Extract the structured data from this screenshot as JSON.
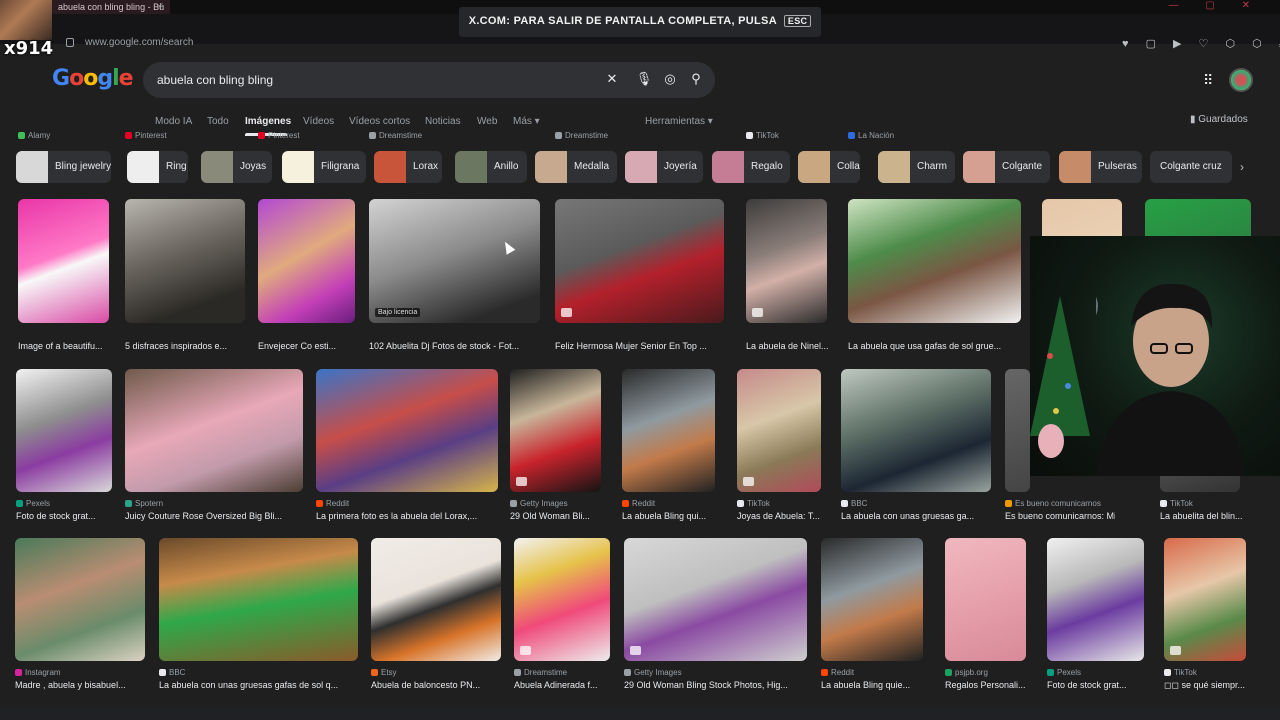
{
  "browser": {
    "tab_title": "abuela con bling bling - Bú",
    "url": "www.google.com/search",
    "fullscreen_banner": "X.COM: PARA SALIR DE PANTALLA COMPLETA, PULSA",
    "fullscreen_key": "ESC",
    "new_tab": "+",
    "window_controls": "— ▢ ✕",
    "extension_icons": "♥ ▢ ▶ ♡ ⬡ ⬡ ⤓ ☰"
  },
  "overlay": {
    "streamer_tag": "x914"
  },
  "google": {
    "logo": "Google",
    "query": "abuela con bling bling",
    "nav_tabs": [
      "Modo IA",
      "Todo",
      "Imágenes",
      "Vídeos",
      "Vídeos cortos",
      "Noticias",
      "Web",
      "Más ▾"
    ],
    "tools": "Herramientas ▾",
    "saved": "Guardados"
  },
  "chips": [
    {
      "label": "Bling jewelry",
      "color": "#d8d8d8"
    },
    {
      "label": "Ring",
      "color": "#eeeeee"
    },
    {
      "label": "Joyas",
      "color": "#8a8a7a"
    },
    {
      "label": "Filigrana",
      "color": "#f6f1dd"
    },
    {
      "label": "Lorax",
      "color": "#c8553a"
    },
    {
      "label": "Anillo",
      "color": "#6b7760"
    },
    {
      "label": "Medalla",
      "color": "#c6a98f"
    },
    {
      "label": "Joyería",
      "color": "#d7a9b3"
    },
    {
      "label": "Regalo",
      "color": "#c47d95"
    },
    {
      "label": "Collar",
      "color": "#c9a881"
    },
    {
      "label": "Charm",
      "color": "#cbb48d"
    },
    {
      "label": "Colgante",
      "color": "#d59f92"
    },
    {
      "label": "Pulseras",
      "color": "#c68c6a"
    },
    {
      "label": "Colgante cruz"
    }
  ],
  "results": [
    {
      "source": "Alamy",
      "source_color": "#3fbf5a",
      "caption": "Image of a beautifu...",
      "bg": "linear-gradient(160deg,#e936a8,#ff79c6 45%,#f8f8f8 55%,#d94aa5)",
      "badge": ""
    },
    {
      "source": "Pinterest",
      "source_color": "#e60023",
      "caption": "5 disfraces inspirados e...",
      "bg": "linear-gradient(160deg,#b8b6ae,#6f6a63 40%,#2b2925 80%)",
      "badge": ""
    },
    {
      "source": "Pinterest",
      "source_color": "#e60023",
      "caption": "Envejecer Co esti...",
      "bg": "linear-gradient(150deg,#b348d4,#e0aa7e 45%,#c33fb7 75%,#6a1d7d)",
      "badge": ""
    },
    {
      "source": "Dreamstime",
      "source_color": "#9aa0a6",
      "caption": "102 Abuelita Dj Fotos de stock - Fot...",
      "bg": "linear-gradient(160deg,#d3d3d3,#8b8b8b 45%,#2a2a2a 85%)",
      "badge": "Bajo licencia"
    },
    {
      "source": "Dreamstime",
      "source_color": "#9aa0a6",
      "caption": "Feliz Hermosa Mujer Senior En Top ...",
      "bg": "linear-gradient(160deg,#777,#5b5b5b 40%,#b3202b 60%,#4a1a1d)",
      "badge": "·"
    },
    {
      "source": "TikTok",
      "source_color": "#e8eaed",
      "caption": "La abuela de Ninel...",
      "bg": "linear-gradient(160deg,#3c3c3c,#8a7d78 40%,#d2b0a8 60%,#2b2b2b)",
      "badge": "·"
    },
    {
      "source": "La Nación",
      "source_color": "#2d6cdf",
      "caption": "La abuela que usa gafas de sol grue...",
      "bg": "linear-gradient(160deg,#cfe4c3,#4e8c4a 35%,#7a5644 60%,#f2f2f2)",
      "badge": ""
    },
    {
      "source": "",
      "source_color": "#9aa0a6",
      "caption": "",
      "bg": "linear-gradient(160deg,#e5c7a8,#f2dcc4)",
      "badge": ""
    },
    {
      "source": "",
      "source_color": "#9aa0a6",
      "caption": "",
      "bg": "linear-gradient(160deg,#27a046,#2f6a3c)",
      "badge": ""
    },
    {
      "source": "Pexels",
      "source_color": "#05a081",
      "caption": "Foto de stock grat...",
      "bg": "linear-gradient(160deg,#f2f2f2,#8e8e8e 40%,#8b3ca1 65%,#d9d9d9)",
      "badge": ""
    },
    {
      "source": "Spotern",
      "source_color": "#2aa58a",
      "caption": "Juicy Couture Rose Oversized Big Bli...",
      "bg": "linear-gradient(160deg,#6f5a4b,#e8a8b8 45%,#c29bab 70%,#4c3e33)",
      "badge": ""
    },
    {
      "source": "Reddit",
      "source_color": "#ff4500",
      "caption": "La primera foto es la abuela del Lorax,...",
      "bg": "linear-gradient(160deg,#3a74c7,#c74e49 40%,#5a3e85 65%,#d6b44b)",
      "badge": ""
    },
    {
      "source": "Getty Images",
      "source_color": "#9aa0a6",
      "caption": "29 Old Woman Bli...",
      "bg": "linear-gradient(160deg,#202020,#c8b69a 35%,#c8232c 65%,#141414)",
      "badge": "·"
    },
    {
      "source": "Reddit",
      "source_color": "#ff4500",
      "caption": "La abuela Bling qui...",
      "bg": "linear-gradient(160deg,#2a2a2a,#8f9aa0 40%,#c27a4a 65%,#222)",
      "badge": ""
    },
    {
      "source": "TikTok",
      "source_color": "#e8eaed",
      "caption": "Joyas de Abuela: T...",
      "bg": "linear-gradient(160deg,#c58a8a,#d8c7a8 40%,#8a7a57 70%,#b14a5a)",
      "badge": "·"
    },
    {
      "source": "BBC",
      "source_color": "#e8eaed",
      "caption": "La abuela con unas gruesas ga...",
      "bg": "linear-gradient(160deg,#bfc9c2,#5d6f66 40%,#1c2633 70%,#9aa5a0)",
      "badge": ""
    },
    {
      "source": "Es bueno comunicarnos",
      "source_color": "#f29900",
      "caption": "Es bueno comunicarnos: Mi ...",
      "bg": "linear-gradient(160deg,#666,#444)",
      "badge": ""
    },
    {
      "source": "TikTok",
      "source_color": "#e8eaed",
      "caption": "La abuelita del blin...",
      "bg": "linear-gradient(160deg,#777,#333)",
      "badge": ""
    },
    {
      "source": "Instagram",
      "source_color": "#d6249f",
      "caption": "Madre , abuela y bisabuel...",
      "bg": "linear-gradient(160deg,#4a7a5a,#b98d72 40%,#6a8c6a 70%,#dcd2c4)",
      "badge": ""
    },
    {
      "source": "BBC",
      "source_color": "#e8eaed",
      "caption": "La abuela con unas gruesas gafas de sol q...",
      "bg": "linear-gradient(170deg,#6a4a2a,#c78a4a 30%,#2fa84a 55%,#8a5a2a)",
      "badge": ""
    },
    {
      "source": "Etsy",
      "source_color": "#f1641e",
      "caption": "Abuela de baloncesto PN...",
      "bg": "linear-gradient(160deg,#f1ece6,#e9e3dc 40%,#2f2f2f 55%,#d8742a 75%,#f1ece6)",
      "badge": ""
    },
    {
      "source": "Dreamstime",
      "source_color": "#9aa0a6",
      "caption": "Abuela Adinerada f...",
      "bg": "linear-gradient(160deg,#f2f2f2,#e6c24a 30%,#f04a7a 60%,#ededed)",
      "badge": "·"
    },
    {
      "source": "Getty Images",
      "source_color": "#9aa0a6",
      "caption": "29 Old Woman Bling Stock Photos, Hig...",
      "bg": "linear-gradient(160deg,#d8d8d8,#bfbfbf 40%,#8a4aa2 60%,#cfcfcf)",
      "badge": "·"
    },
    {
      "source": "Reddit",
      "source_color": "#ff4500",
      "caption": "La abuela Bling quie...",
      "bg": "linear-gradient(160deg,#2a2a2a,#8f9aa0 40%,#c27a4a 65%,#222)",
      "badge": ""
    },
    {
      "source": "psjpb.org",
      "source_color": "#1aa260",
      "caption": "Regalos Personali...",
      "bg": "linear-gradient(160deg,#f0b8c0,#e6a0ab 50%,#d88a98)",
      "badge": ""
    },
    {
      "source": "Pexels",
      "source_color": "#05a081",
      "caption": "Foto de stock grat...",
      "bg": "linear-gradient(160deg,#f0f0f0,#b9b9b9 35%,#6b3ca0 60%,#e8e8e8)",
      "badge": ""
    },
    {
      "source": "TikTok",
      "source_color": "#e8eaed",
      "caption": "◻◻ se qué siempr...",
      "bg": "linear-gradient(160deg,#d86a4a,#e7c7a8 40%,#5a8a4a 70%,#c84a3a)",
      "badge": "·"
    }
  ]
}
